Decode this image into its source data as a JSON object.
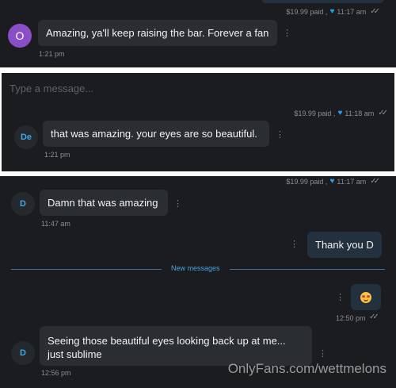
{
  "top": {
    "paid_meta": "$19.99 paid ,",
    "paid_time": "11:17 am",
    "message": "Amazing, ya'll keep raising the bar. Forever a fan",
    "avatar_letter": "O",
    "time": "1:21 pm"
  },
  "composer": {
    "placeholder": "Type a message..."
  },
  "middle": {
    "paid_meta": "$19.99 paid ,",
    "paid_time": "11:18 am",
    "avatar_letters": "De",
    "message": "that was amazing. your eyes are so beautiful.",
    "time": "1:21 pm"
  },
  "thread": {
    "paid_meta": "$19.99 paid ,",
    "paid_time": "11:17 am",
    "msg1": {
      "avatar": "D",
      "text": "Damn that was amazing",
      "time": "11:47 am"
    },
    "reply": {
      "text": "Thank you D"
    },
    "new_messages_label": "New messages",
    "emoji_time": "12:50 pm",
    "msg2": {
      "avatar": "D",
      "text": "Seeing those beautiful eyes looking back up at me... just sublime",
      "time": "12:56 pm"
    },
    "watermark": "OnlyFans.com/wettmelons"
  },
  "icons": {
    "heart": "heart-icon",
    "read": "double-check-icon",
    "options": "kebab-menu-icon",
    "emoji": "smiling-face-with-hearts"
  },
  "colors": {
    "background": "#1b1c1f",
    "bubble": "#2a2d32",
    "accent": "#1da1f2",
    "avatar_purple": "#8a4fc7"
  }
}
